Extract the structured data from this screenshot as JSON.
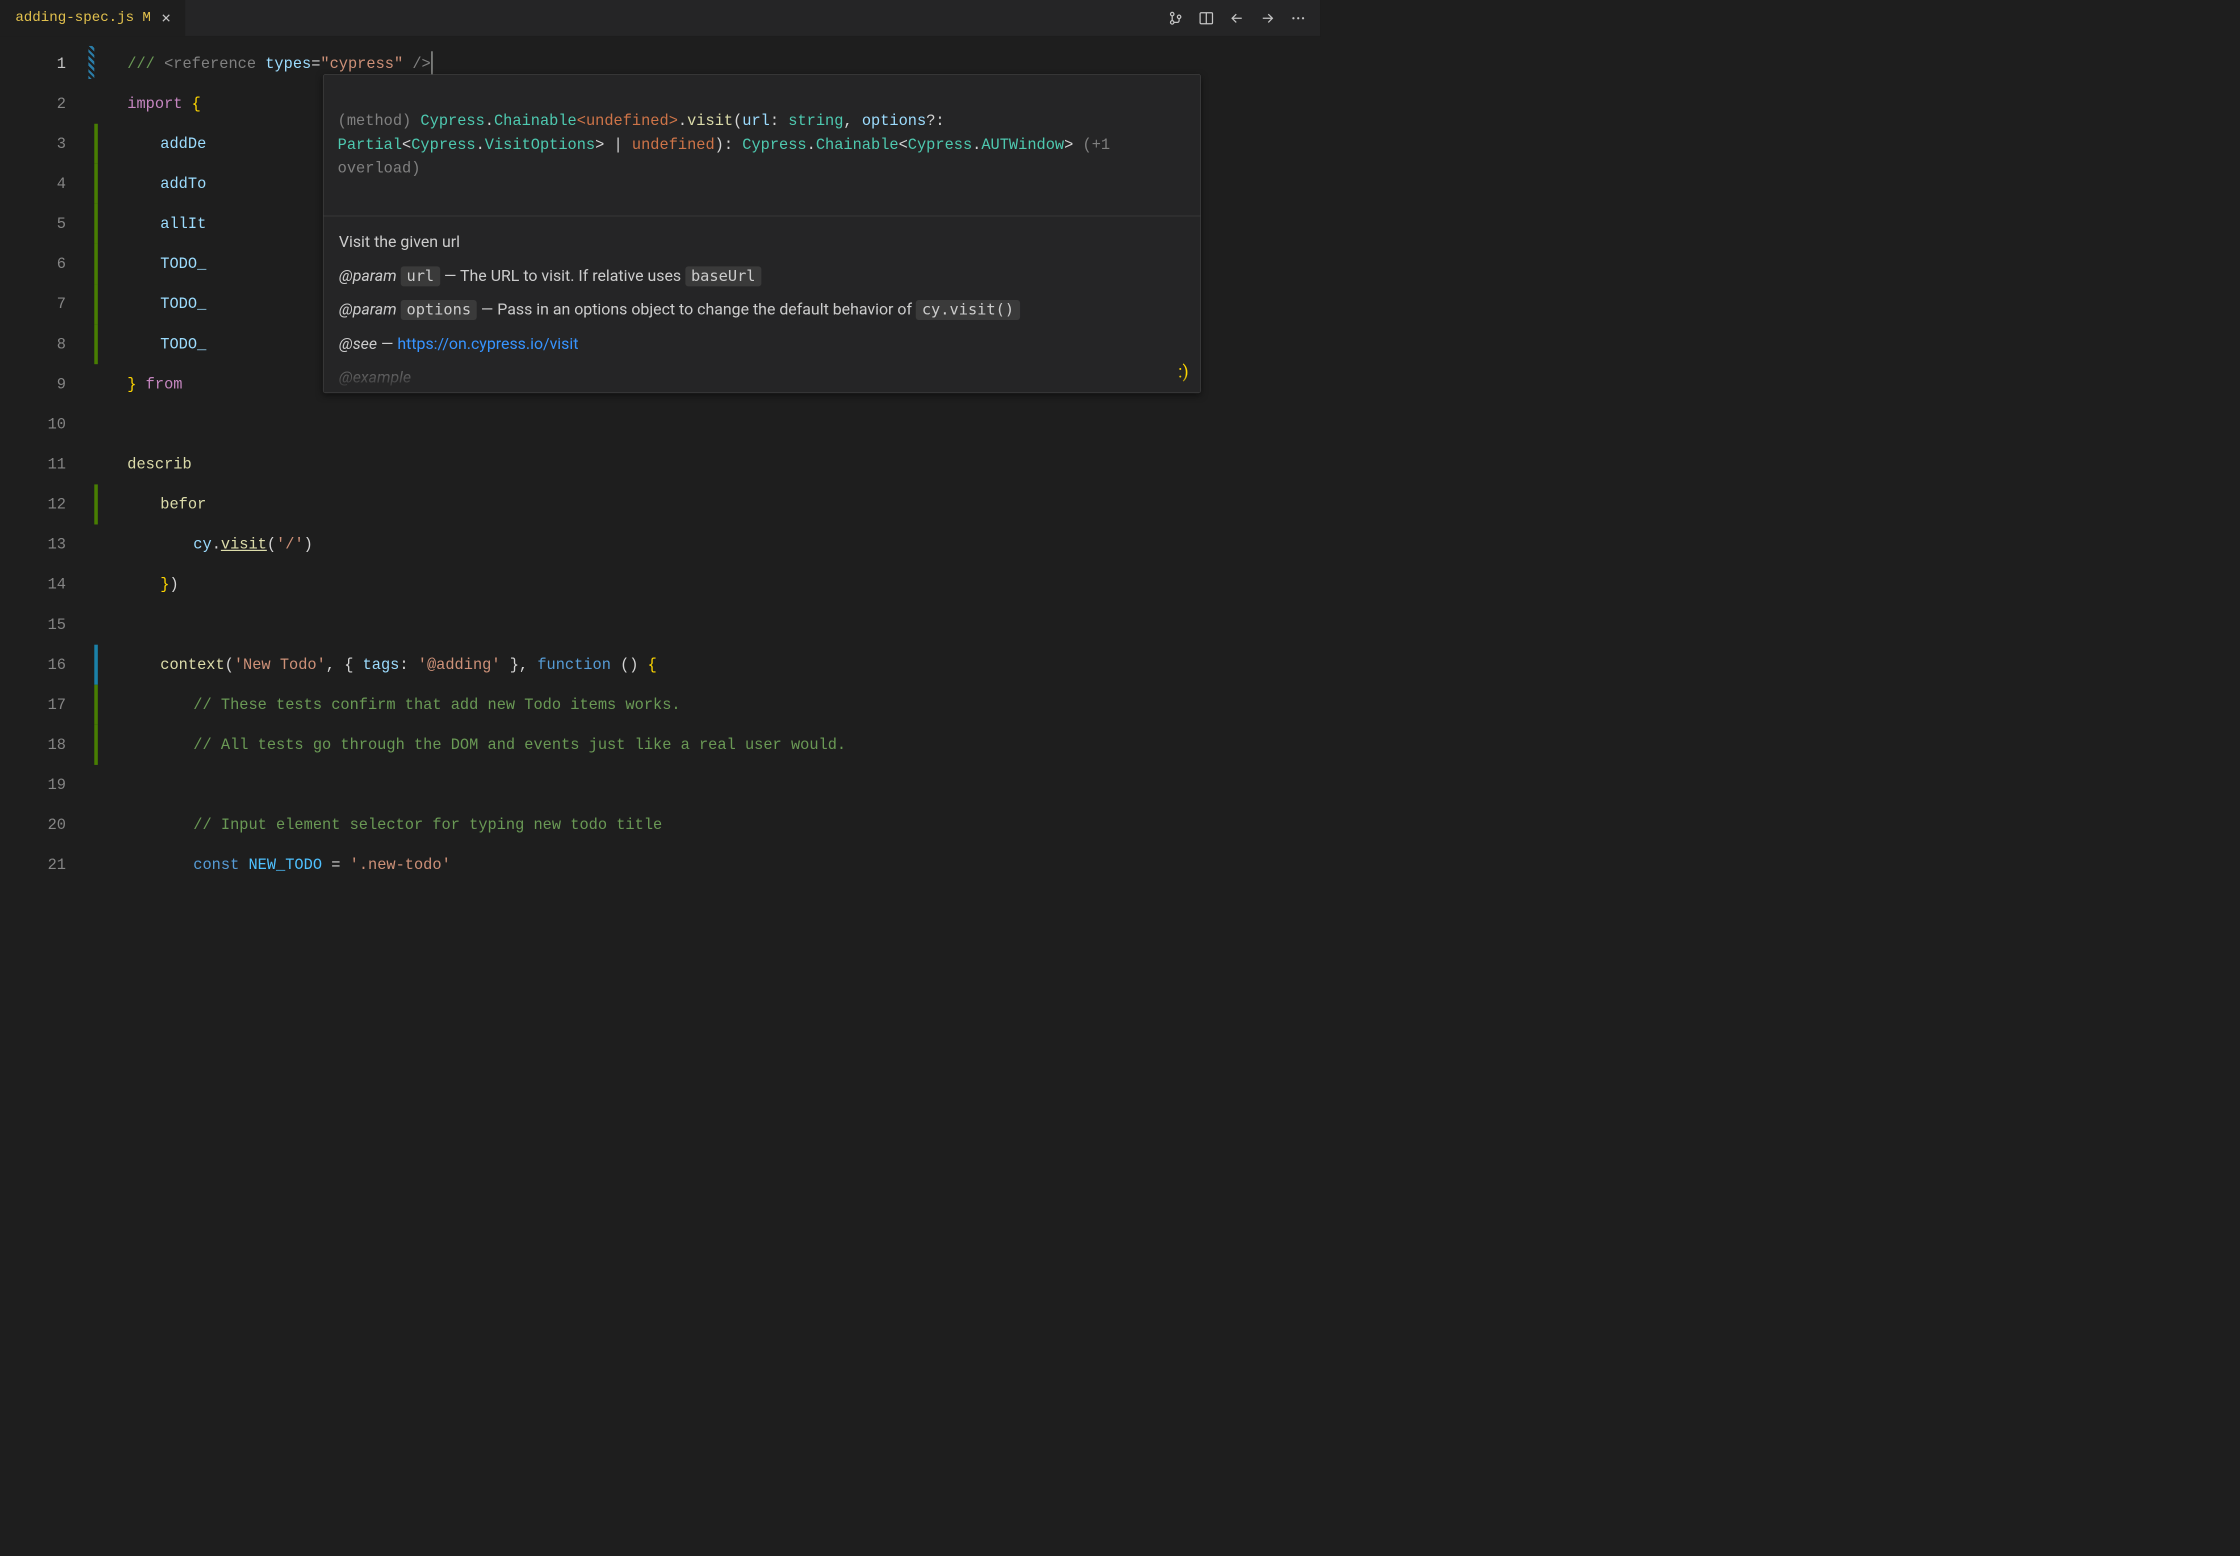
{
  "tab": {
    "filename": "adding-spec.js",
    "modified_marker": "M"
  },
  "gutter_lines": [
    "1",
    "2",
    "3",
    "4",
    "5",
    "6",
    "7",
    "8",
    "9",
    "10",
    "11",
    "12",
    "13",
    "14",
    "15",
    "16",
    "17",
    "18",
    "19",
    "20",
    "21"
  ],
  "code": {
    "l1": {
      "comment": "/// ",
      "lt": "<",
      "ref": "reference",
      "sp": " ",
      "attr": "types",
      "eq": "=",
      "val": "\"cypress\"",
      "sp2": " ",
      "close": "/>"
    },
    "l2": {
      "kw": "import",
      "sp": " ",
      "br": "{"
    },
    "l3": {
      "ident": "addDe"
    },
    "l4": {
      "ident": "addTo"
    },
    "l5": {
      "ident": "allIt"
    },
    "l6": {
      "ident": "TODO_"
    },
    "l7": {
      "ident": "TODO_"
    },
    "l8": {
      "ident": "TODO_"
    },
    "l9": {
      "br": "}",
      "sp": " ",
      "kw": "from",
      "sp2": " "
    },
    "l11": {
      "fn": "describ"
    },
    "l12": {
      "ident": "befor"
    },
    "l13": {
      "obj": "cy",
      "dot": ".",
      "fn": "visit",
      "p1": "(",
      "str": "'/'",
      "p2": ")"
    },
    "l14": {
      "br": "}",
      "p": ")"
    },
    "l16": {
      "fn": "context",
      "p1": "(",
      "str1": "'New Todo'",
      "comma1": ", ",
      "br1": "{",
      "sp": " ",
      "prop": "tags",
      "colon": ": ",
      "str2": "'@adding'",
      "sp2": " ",
      "br2": "}",
      "comma2": ", ",
      "kw": "function",
      "sp3": " ",
      "p2": "(",
      "p3": ")",
      "sp4": " ",
      "br3": "{"
    },
    "l17": {
      "comment": "// These tests confirm that add new Todo items works."
    },
    "l18": {
      "comment": "// All tests go through the DOM and events just like a real user would."
    },
    "l20": {
      "comment": "// Input element selector for typing new todo title"
    },
    "l21": {
      "kw": "const",
      "sp": " ",
      "ident": "NEW_TODO",
      "sp2": " ",
      "eq": "=",
      "sp3": " ",
      "str": "'.new-todo'"
    }
  },
  "hover": {
    "sig": {
      "prefix": "(method) ",
      "type1": "Cypress",
      "dot1": ".",
      "type2": "Chainable",
      "lt1": "<",
      "undef": "undefined",
      "gt1": ">",
      "dot2": ".",
      "fn": "visit",
      "op": "(",
      "p1name": "url",
      "colon1": ": ",
      "p1type": "string",
      "comma": ", ",
      "p2name": "options",
      "q": "?",
      "colon2": ": ",
      "p2t1": "Partial",
      "lt2": "<",
      "p2t2a": "Cypress",
      "p2dot": ".",
      "p2t2b": "VisitOptions",
      "gt2": ">",
      "pipe": " | ",
      "undef2": "undefined",
      "cp": ")",
      "colon3": ": ",
      "r1": "Cypress",
      "rdot": ".",
      "r2": "Chainable",
      "lt3": "<",
      "r3a": "Cypress",
      "r3dot": ".",
      "r3b": "AUTWindow",
      "gt3": ">",
      "overload": " (+1 overload)"
    },
    "doc": {
      "line1": "Visit the given url",
      "param_label": "@param",
      "url_code": "url",
      "url_desc": " — The URL to visit. If relative uses ",
      "baseurl_code": "baseUrl",
      "options_code": "options",
      "options_desc": " — Pass in an options object to change the default behavior of ",
      "cyvisit_code": "cy.visit()",
      "see_label": "@see",
      "see_dash": " — ",
      "see_link": "https://on.cypress.io/visit",
      "partial": "@example"
    }
  },
  "bracket_pair": ":)"
}
